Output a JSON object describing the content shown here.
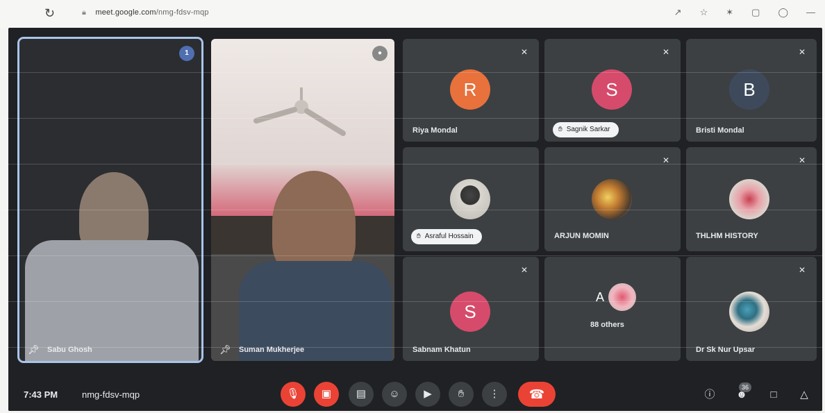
{
  "browser": {
    "url_host": "meet.google.com",
    "url_path": "/nmg-fdsv-mqp",
    "icons": [
      "reload-icon",
      "lock-icon",
      "share-icon",
      "star-icon",
      "extensions-icon",
      "tab-icon",
      "profile-icon",
      "menu-icon"
    ]
  },
  "meeting": {
    "time": "7:43 PM",
    "code": "nmg-fdsv-mqp",
    "people_count": "36"
  },
  "tiles": {
    "t1": {
      "name": "Sabu Ghosh",
      "speaking": "1"
    },
    "t2": {
      "name": "Suman Mukherjee"
    },
    "riya": {
      "name": "Riya Mondal",
      "initial": "R",
      "color": "#e8713c"
    },
    "sagnik": {
      "name": "Sagnik Sarkar",
      "initial": "S",
      "color": "#d64b6b"
    },
    "bristi": {
      "name": "Bristi Mondal",
      "initial": "B",
      "color": "#3e4a5c"
    },
    "asraful": {
      "name": "Asraful Hossain"
    },
    "arjun": {
      "name": "ARJUN MOMIN"
    },
    "thlhm": {
      "name": "THLHM HISTORY"
    },
    "sabnam": {
      "name": "Sabnam Khatun",
      "initial": "S",
      "color": "#d64b6b"
    },
    "others": {
      "name": "88 others",
      "initial": "A"
    },
    "drsk": {
      "name": "Dr Sk Nur Upsar"
    }
  },
  "controls": {
    "mic": "mic-off-icon",
    "camera": "camera-off-icon",
    "captions": "captions-icon",
    "emoji": "emoji-icon",
    "present": "present-icon",
    "hand": "raise-hand-icon",
    "more": "more-options-icon",
    "leave": "leave-call-icon",
    "info": "info-icon",
    "people": "people-icon",
    "chat": "chat-icon",
    "activities": "activities-icon"
  },
  "colors": {
    "background": "#202124",
    "tile": "#3c4043",
    "accent_red": "#ea4335",
    "highlight": "#a9c4ea"
  }
}
